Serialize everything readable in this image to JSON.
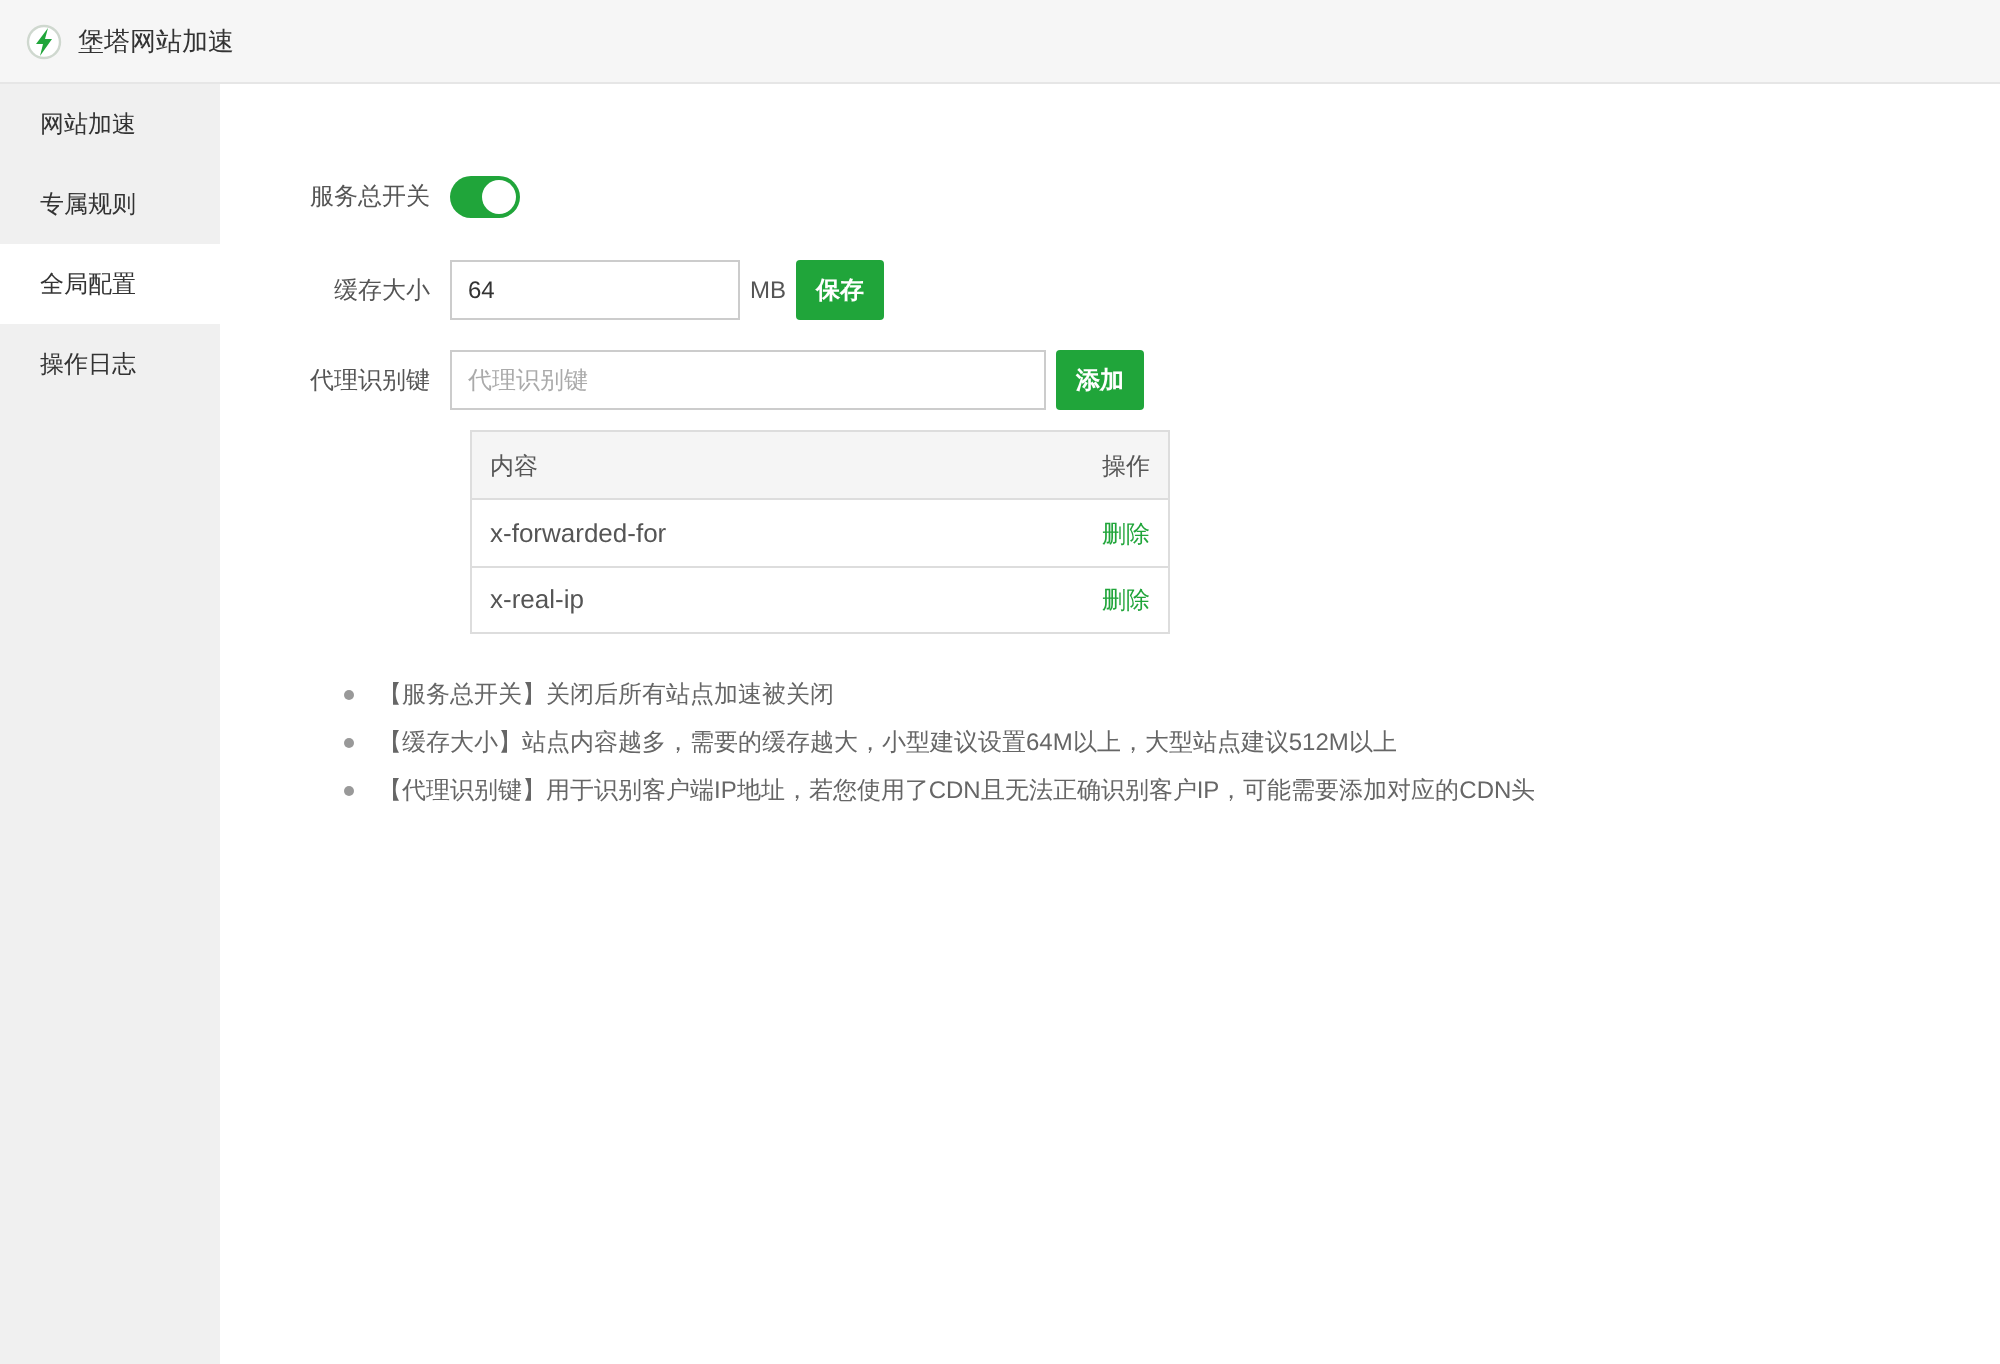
{
  "window": {
    "title": "堡塔网站加速"
  },
  "sidebar": {
    "items": [
      {
        "label": "网站加速",
        "selected": false
      },
      {
        "label": "专属规则",
        "selected": false
      },
      {
        "label": "全局配置",
        "selected": true
      },
      {
        "label": "操作日志",
        "selected": false
      }
    ]
  },
  "form": {
    "service_switch": {
      "label": "服务总开关",
      "on": true
    },
    "cache_size": {
      "label": "缓存大小",
      "value": "64",
      "unit": "MB",
      "button": "保存"
    },
    "proxy_key": {
      "label": "代理识别键",
      "placeholder": "代理识别键",
      "button": "添加"
    }
  },
  "table": {
    "columns": [
      "内容",
      "操作"
    ],
    "rows": [
      {
        "content": "x-forwarded-for",
        "action": "删除"
      },
      {
        "content": "x-real-ip",
        "action": "删除"
      }
    ]
  },
  "notes": [
    "【服务总开关】关闭后所有站点加速被关闭",
    "【缓存大小】站点内容越多，需要的缓存越大，小型建议设置64M以上，大型站点建议512M以上",
    "【代理识别键】用于识别客户端IP地址，若您使用了CDN且无法正确识别客户IP，可能需要添加对应的CDN头"
  ]
}
